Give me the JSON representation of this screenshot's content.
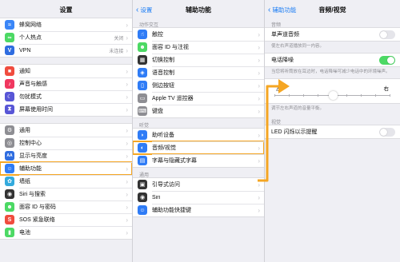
{
  "settings": {
    "title": "设置",
    "group0": [
      {
        "icon": "wifi-icon",
        "color": "#3a86f7",
        "glyph": "≈",
        "label": "蜂窝网络"
      },
      {
        "icon": "hotspot-icon",
        "color": "#4cd964",
        "glyph": "∞",
        "label": "个人热点",
        "value": "关闭"
      },
      {
        "icon": "vpn-icon",
        "color": "#2f6de0",
        "glyph": "V",
        "label": "VPN",
        "value": "未连接"
      }
    ],
    "group1": [
      {
        "icon": "notification-icon",
        "color": "#f04c3e",
        "glyph": "■",
        "label": "通知"
      },
      {
        "icon": "sound-icon",
        "color": "#f0375f",
        "glyph": "♪",
        "label": "声音与触感"
      },
      {
        "icon": "moon-icon",
        "color": "#5856d6",
        "glyph": "☾",
        "label": "勿扰模式"
      },
      {
        "icon": "hourglass-icon",
        "color": "#5856d6",
        "glyph": "⧗",
        "label": "屏幕使用时间"
      }
    ],
    "group2": [
      {
        "icon": "gear-icon",
        "color": "#8e8e93",
        "glyph": "⚙",
        "label": "通用"
      },
      {
        "icon": "control-center-icon",
        "color": "#8e8e93",
        "glyph": "◎",
        "label": "控制中心"
      },
      {
        "icon": "display-icon",
        "color": "#2f6de0",
        "glyph": "AA",
        "label": "显示与亮度"
      },
      {
        "icon": "accessibility-icon",
        "color": "#2f7cf6",
        "glyph": "☺",
        "label": "辅助功能"
      },
      {
        "icon": "wallpaper-icon",
        "color": "#33aadd",
        "glyph": "✿",
        "label": "墙纸"
      },
      {
        "icon": "siri-icon",
        "color": "#333333",
        "glyph": "◉",
        "label": "Siri 与搜索"
      },
      {
        "icon": "faceid-icon",
        "color": "#4cd964",
        "glyph": "☻",
        "label": "面容 ID 与密码"
      },
      {
        "icon": "sos-icon",
        "color": "#f04c3e",
        "glyph": "S",
        "label": "SOS 紧急联络"
      },
      {
        "icon": "battery-icon",
        "color": "#4cd964",
        "glyph": "▮",
        "label": "电池"
      }
    ]
  },
  "accessibility": {
    "back": "设置",
    "title": "辅助功能",
    "section_interaction": "动作交互",
    "interaction": [
      {
        "icon": "touch-icon",
        "color": "#2f7cf6",
        "glyph": "☝",
        "label": "触控"
      },
      {
        "icon": "faceid-attention-icon",
        "color": "#4cd964",
        "glyph": "☻",
        "label": "面容 ID 与注视"
      },
      {
        "icon": "switch-control-icon",
        "color": "#333333",
        "glyph": "▦",
        "label": "切换控制"
      },
      {
        "icon": "voice-control-icon",
        "color": "#2f7cf6",
        "glyph": "◈",
        "label": "语音控制"
      },
      {
        "icon": "side-button-icon",
        "color": "#2f7cf6",
        "glyph": "▯",
        "label": "侧边按钮"
      },
      {
        "icon": "apple-tv-remote-icon",
        "color": "#8e8e93",
        "glyph": "▭",
        "label": "Apple TV 遥控器"
      },
      {
        "icon": "keyboard-icon",
        "color": "#8e8e93",
        "glyph": "⌨",
        "label": "键盘"
      }
    ],
    "section_hearing": "听觉",
    "hearing": [
      {
        "icon": "hearing-device-icon",
        "color": "#2f7cf6",
        "glyph": "◗",
        "label": "助听设备"
      },
      {
        "icon": "audio-visual-icon",
        "color": "#2f7cf6",
        "glyph": "◐",
        "label": "音频/视觉"
      },
      {
        "icon": "subtitles-icon",
        "color": "#2f7cf6",
        "glyph": "▤",
        "label": "字幕与隐藏式字幕"
      }
    ],
    "section_general": "通用",
    "general": [
      {
        "icon": "guided-access-icon",
        "color": "#333333",
        "glyph": "▣",
        "label": "引导式访问"
      },
      {
        "icon": "siri-icon",
        "color": "#333333",
        "glyph": "◉",
        "label": "Siri"
      },
      {
        "icon": "accessibility-shortcut-icon",
        "color": "#2f7cf6",
        "glyph": "☺",
        "label": "辅助功能快捷键"
      }
    ]
  },
  "audio": {
    "back": "辅助功能",
    "title": "音频/视觉",
    "section_audio": "音频",
    "mono_label": "单声道音频",
    "mono_on": false,
    "mono_desc": "使左右声道播放同一内容。",
    "noise_label": "电话降噪",
    "noise_on": true,
    "noise_desc": "当您将听筒放在耳边时，电话降噪可减少电话中的环境噪声。",
    "balance_left": "左",
    "balance_right": "右",
    "balance_desc": "调节左右声道的音量平衡。",
    "section_visual": "视觉",
    "led_label": "LED 闪烁以示提醒",
    "led_on": false
  },
  "colors": {
    "highlight": "#f5a623",
    "link": "#1a7cf5"
  }
}
